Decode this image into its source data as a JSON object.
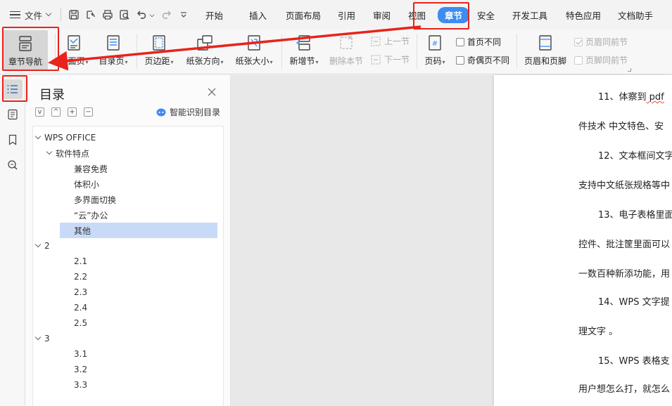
{
  "menubar": {
    "file_label": "文件",
    "tabs": [
      "开始",
      "插入",
      "页面布局",
      "引用",
      "审阅",
      "视图",
      "章节",
      "安全",
      "开发工具",
      "特色应用",
      "文档助手"
    ],
    "active_tab": "章节"
  },
  "ribbon": {
    "chapter_nav": "章节导航",
    "cover_page": "封面页",
    "toc_page": "目录页",
    "margins": "页边距",
    "orientation": "纸张方向",
    "paper_size": "纸张大小",
    "new_section": "新增节",
    "delete_section": "删除本节",
    "prev_section": "上一节",
    "next_section": "下一节",
    "page_number": "页码",
    "first_page_diff": "首页不同",
    "odd_even_diff": "奇偶页不同",
    "header_footer": "页眉和页脚",
    "header_same_prev": "页眉同前节",
    "footer_same_prev": "页脚同前节"
  },
  "toc": {
    "title": "目录",
    "tool_collapse": "v",
    "tool_expand": "^",
    "tool_add": "+",
    "tool_remove": "−",
    "smart_detect": "智能识别目录",
    "items": [
      {
        "label": "WPS OFFICE",
        "level": 0,
        "expanded": true
      },
      {
        "label": "软件特点",
        "level": 1,
        "expanded": true
      },
      {
        "label": "兼容免费",
        "level": 2
      },
      {
        "label": "体积小",
        "level": 2
      },
      {
        "label": "多界面切换",
        "level": 2
      },
      {
        "label": "“云”办公",
        "level": 2
      },
      {
        "label": "其他",
        "level": 2,
        "selected": true
      },
      {
        "label": "2",
        "level": 0,
        "expanded": true
      },
      {
        "label": "2.1",
        "level": 2
      },
      {
        "label": "2.2",
        "level": 2
      },
      {
        "label": "2.3",
        "level": 2
      },
      {
        "label": "2.4",
        "level": 2
      },
      {
        "label": "2.5",
        "level": 2
      },
      {
        "label": "3",
        "level": 0,
        "expanded": true
      },
      {
        "label": "3.1",
        "level": 2
      },
      {
        "label": "3.2",
        "level": 2
      },
      {
        "label": "3.3",
        "level": 2
      }
    ]
  },
  "document": {
    "lines": [
      {
        "text": "11、体察到",
        "pdf": "pdf",
        "indent": true
      },
      {
        "text": "件技术  中文特色、安"
      },
      {
        "text": "12、文本框间文字",
        "indent": true
      },
      {
        "text": "支持中文纸张规格等中"
      },
      {
        "text": "13、电子表格里面",
        "indent": true
      },
      {
        "text": "控件、批注筐里面可以"
      },
      {
        "text": "一数百种新添功能，用"
      },
      {
        "text": "14、WPS 文字提",
        "indent": true
      },
      {
        "text": "理文字 。"
      },
      {
        "text": "15、WPS 表格支",
        "indent": true
      },
      {
        "text": "用户想怎么打，就怎么"
      }
    ]
  },
  "colors": {
    "accent": "#3d8cf0",
    "annotation": "#e8231b",
    "selected_row": "#c9daf8"
  }
}
